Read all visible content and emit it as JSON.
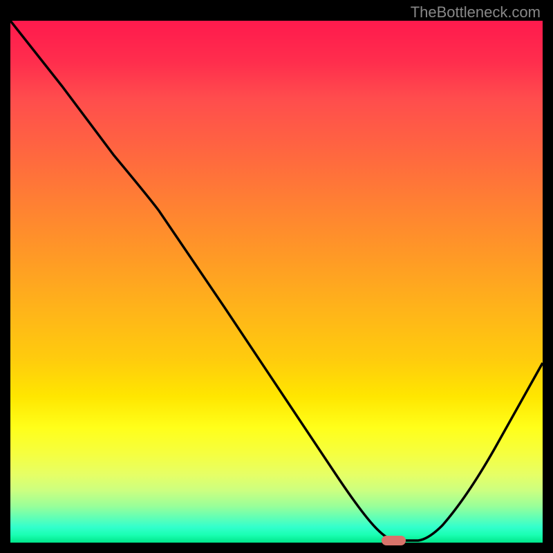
{
  "watermark": "TheBottleneck.com",
  "chart_data": {
    "type": "line",
    "title": "",
    "xlabel": "",
    "ylabel": "",
    "x": [
      0,
      10,
      20,
      27,
      35,
      45,
      55,
      63,
      67,
      70,
      73,
      75,
      80,
      85,
      90,
      95,
      100
    ],
    "values": [
      100,
      87,
      74,
      66,
      55,
      40,
      25,
      12,
      6,
      2,
      0,
      0,
      3,
      10,
      20,
      32,
      45
    ],
    "xlim": [
      0,
      100
    ],
    "ylim": [
      0,
      100
    ],
    "marker_position": {
      "x": 72,
      "y": 0
    },
    "gradient_colors": {
      "top": "#ff1a4d",
      "bottom": "#00e68a"
    }
  }
}
